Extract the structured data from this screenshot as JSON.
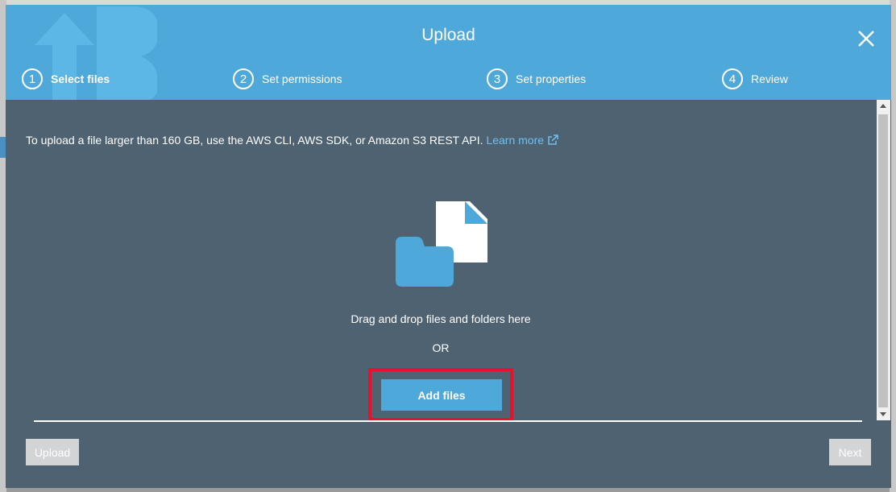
{
  "modal": {
    "title": "Upload",
    "close_icon": "close-icon",
    "steps": [
      {
        "number": "1",
        "label": "Select files",
        "active": true
      },
      {
        "number": "2",
        "label": "Set permissions",
        "active": false
      },
      {
        "number": "3",
        "label": "Set properties",
        "active": false
      },
      {
        "number": "4",
        "label": "Review",
        "active": false
      }
    ]
  },
  "body": {
    "notice_text": "To upload a file larger than 160 GB, use the AWS CLI, AWS SDK, or Amazon S3 REST API.",
    "learn_more_label": "Learn more",
    "illustration_icon": "files-folder-icon",
    "drag_text": "Drag and drop files and folders here",
    "or_text": "OR",
    "add_files_label": "Add files"
  },
  "footer": {
    "upload_label": "Upload",
    "next_label": "Next"
  },
  "colors": {
    "header_blue": "#4fa8da",
    "body_slate": "#4e6271",
    "highlight_red": "#e8112d",
    "link_blue": "#6ec0f0"
  }
}
